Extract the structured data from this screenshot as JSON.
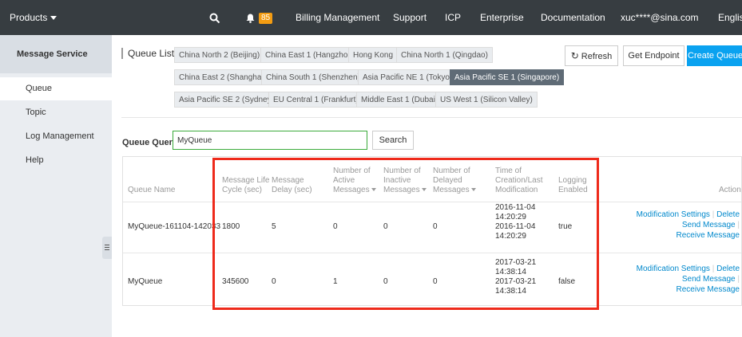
{
  "topbar": {
    "products": "Products",
    "search_icon": "search-icon",
    "bell_icon": "bell-icon",
    "notification_count": "85",
    "billing": "Billing Management",
    "support": "Support",
    "icp": "ICP",
    "enterprise": "Enterprise",
    "documentation": "Documentation",
    "user": "xuc****@sina.com",
    "language": "English"
  },
  "sidebar": {
    "title": "Message Service",
    "items": [
      "Queue",
      "Topic",
      "Log Management",
      "Help"
    ]
  },
  "queue_list": {
    "label": "Queue List",
    "regions": [
      "China North 2 (Beijing)",
      "China East 1 (Hangzhou)",
      "Hong Kong",
      "China North 1 (Qingdao)",
      "China East 2 (Shanghai)",
      "China South 1 (Shenzhen)",
      "Asia Pacific NE 1 (Tokyo)",
      "Asia Pacific SE 1 (Singapore)",
      "Asia Pacific SE 2 (Sydney)",
      "EU Central 1 (Frankfurt)",
      "Middle East 1 (Dubai)",
      "US West 1 (Silicon Valley)"
    ],
    "selected_region": "Asia Pacific SE 1 (Singapore)",
    "refresh": "Refresh",
    "get_endpoint": "Get Endpoint",
    "create_queue": "Create Queue"
  },
  "query": {
    "label": "Queue Query :",
    "value": "MyQueue",
    "search": "Search"
  },
  "table": {
    "headers": {
      "queue_name": "Queue Name",
      "life_cycle": [
        "Message Life",
        "Cycle (sec)"
      ],
      "delay": [
        "Message",
        "Delay (sec)"
      ],
      "active": [
        "Number of",
        "Active",
        "Messages"
      ],
      "inactive": [
        "Number of",
        "Inactive",
        "Messages"
      ],
      "delayed": [
        "Number of",
        "Delayed",
        "Messages"
      ],
      "time": [
        "Time of",
        "Creation/Last",
        "Modification"
      ],
      "logging": [
        "Logging",
        "Enabled"
      ],
      "action": "Action"
    },
    "rows": [
      {
        "name": "MyQueue-161104-142033",
        "life_cycle": "1800",
        "delay": "5",
        "active": "0",
        "inactive": "0",
        "delayed": "0",
        "created": [
          "2016-11-04",
          "14:20:29"
        ],
        "modified": [
          "2016-11-04",
          "14:20:29"
        ],
        "logging": "true"
      },
      {
        "name": "MyQueue",
        "life_cycle": "345600",
        "delay": "0",
        "active": "1",
        "inactive": "0",
        "delayed": "0",
        "created": [
          "2017-03-21",
          "14:38:14"
        ],
        "modified": [
          "2017-03-21",
          "14:38:14"
        ],
        "logging": "false"
      }
    ],
    "actions": {
      "modification_settings": "Modification Settings",
      "delete": "Delete",
      "send_message": "Send Message",
      "receive_message": "Receive Message",
      "separator": "|"
    }
  },
  "colors": {
    "topbar": "#373d41",
    "primary": "#0aa2f0",
    "highlight_box": "#ee2a1b",
    "selected_region": "#5f6b76",
    "link": "#0088cc"
  }
}
